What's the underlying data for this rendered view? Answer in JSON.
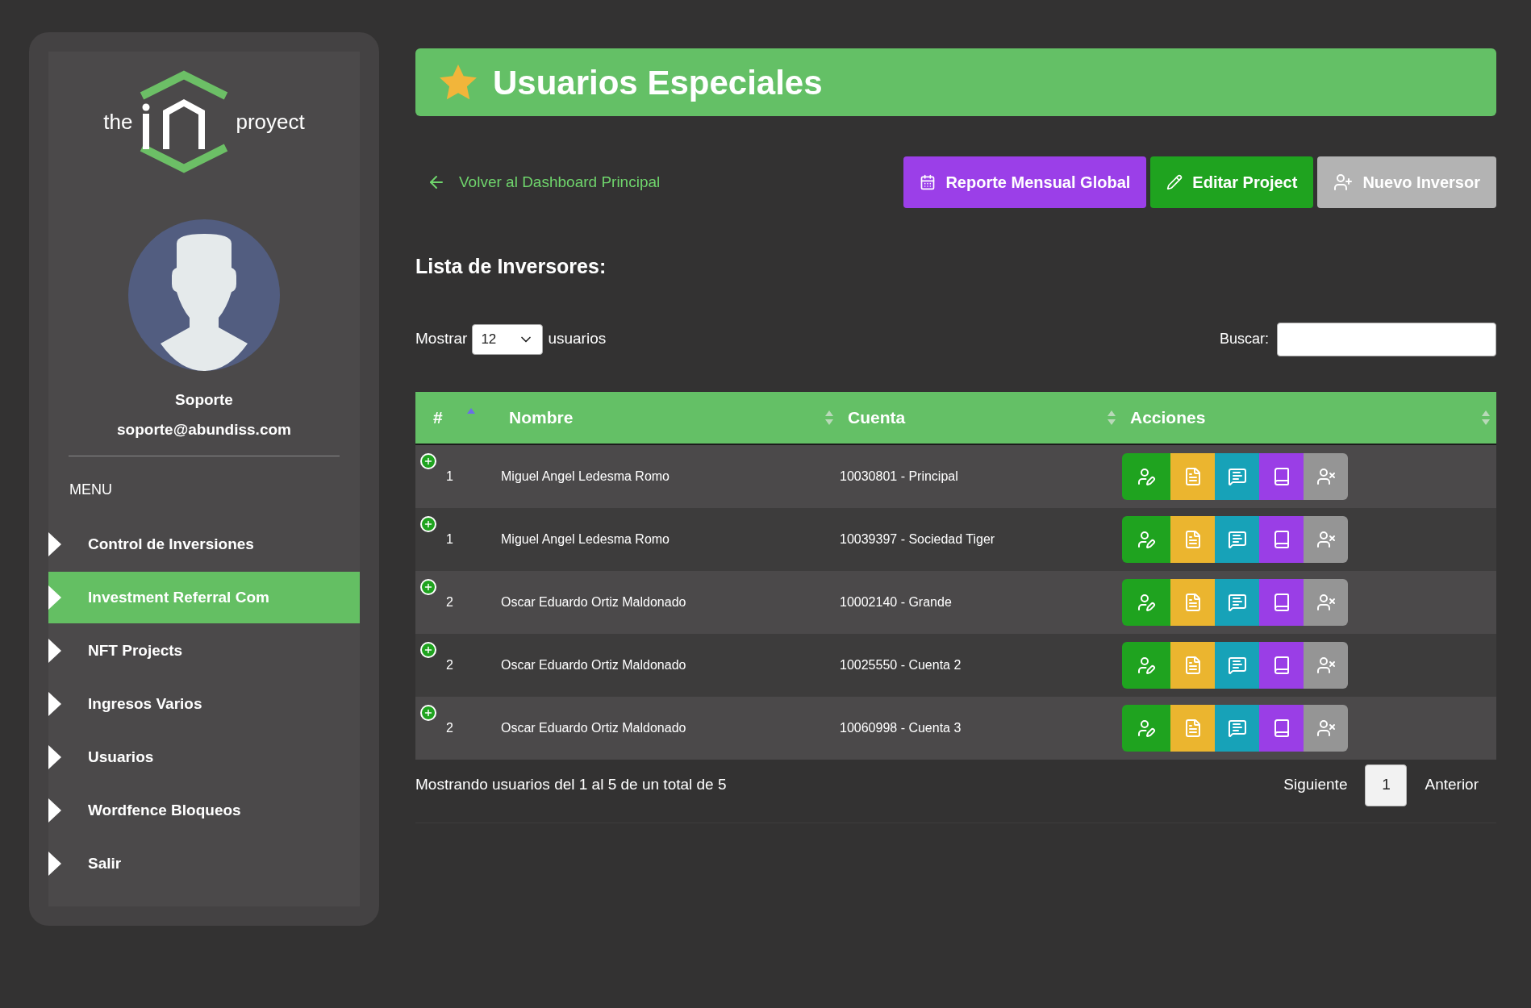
{
  "logo": {
    "left_text": "the",
    "right_text": "proyect"
  },
  "user": {
    "name": "Soporte",
    "email": "soporte@abundiss.com"
  },
  "menu": {
    "heading": "MENU",
    "items": [
      {
        "label": "Control de Inversiones",
        "selected": false
      },
      {
        "label": "Investment Referral Com",
        "selected": true
      },
      {
        "label": "NFT Projects",
        "selected": false
      },
      {
        "label": "Ingresos Varios",
        "selected": false
      },
      {
        "label": "Usuarios",
        "selected": false
      },
      {
        "label": "Wordfence Bloqueos",
        "selected": false
      },
      {
        "label": "Salir",
        "selected": false
      }
    ]
  },
  "page_title": "Usuarios Especiales",
  "back_link": "Volver al Dashboard Principal",
  "buttons": [
    {
      "kind": "report",
      "label": "Reporte Mensual Global"
    },
    {
      "kind": "edit",
      "label": "Editar Project"
    },
    {
      "kind": "new",
      "label": "Nuevo Inversor"
    }
  ],
  "list_title": "Lista de Inversores:",
  "length_control": {
    "before": "Mostrar",
    "value": "12",
    "after": "usuarios"
  },
  "search": {
    "label": "Buscar:"
  },
  "table": {
    "columns": [
      {
        "label": "#",
        "sorted": true
      },
      {
        "label": "Nombre",
        "sorted": false
      },
      {
        "label": "Cuenta",
        "sorted": false
      },
      {
        "label": "Acciones",
        "sorted": false
      }
    ],
    "rows": [
      {
        "number": "1",
        "name": "Miguel Angel Ledesma Romo",
        "account": "10030801 - Principal"
      },
      {
        "number": "1",
        "name": "Miguel Angel Ledesma Romo",
        "account": "10039397 - Sociedad Tiger"
      },
      {
        "number": "2",
        "name": "Oscar Eduardo Ortiz Maldonado",
        "account": "10002140 - Grande"
      },
      {
        "number": "2",
        "name": "Oscar Eduardo Ortiz Maldonado",
        "account": "10025550 - Cuenta 2"
      },
      {
        "number": "2",
        "name": "Oscar Eduardo Ortiz Maldonado",
        "account": "10060998 - Cuenta 3"
      }
    ]
  },
  "summary": "Mostrando usuarios del 1 al 5 de un total de 5",
  "pagination": [
    {
      "label": "Siguiente",
      "selected": false
    },
    {
      "label": "1",
      "selected": true
    },
    {
      "label": "Anterior",
      "selected": false
    }
  ]
}
